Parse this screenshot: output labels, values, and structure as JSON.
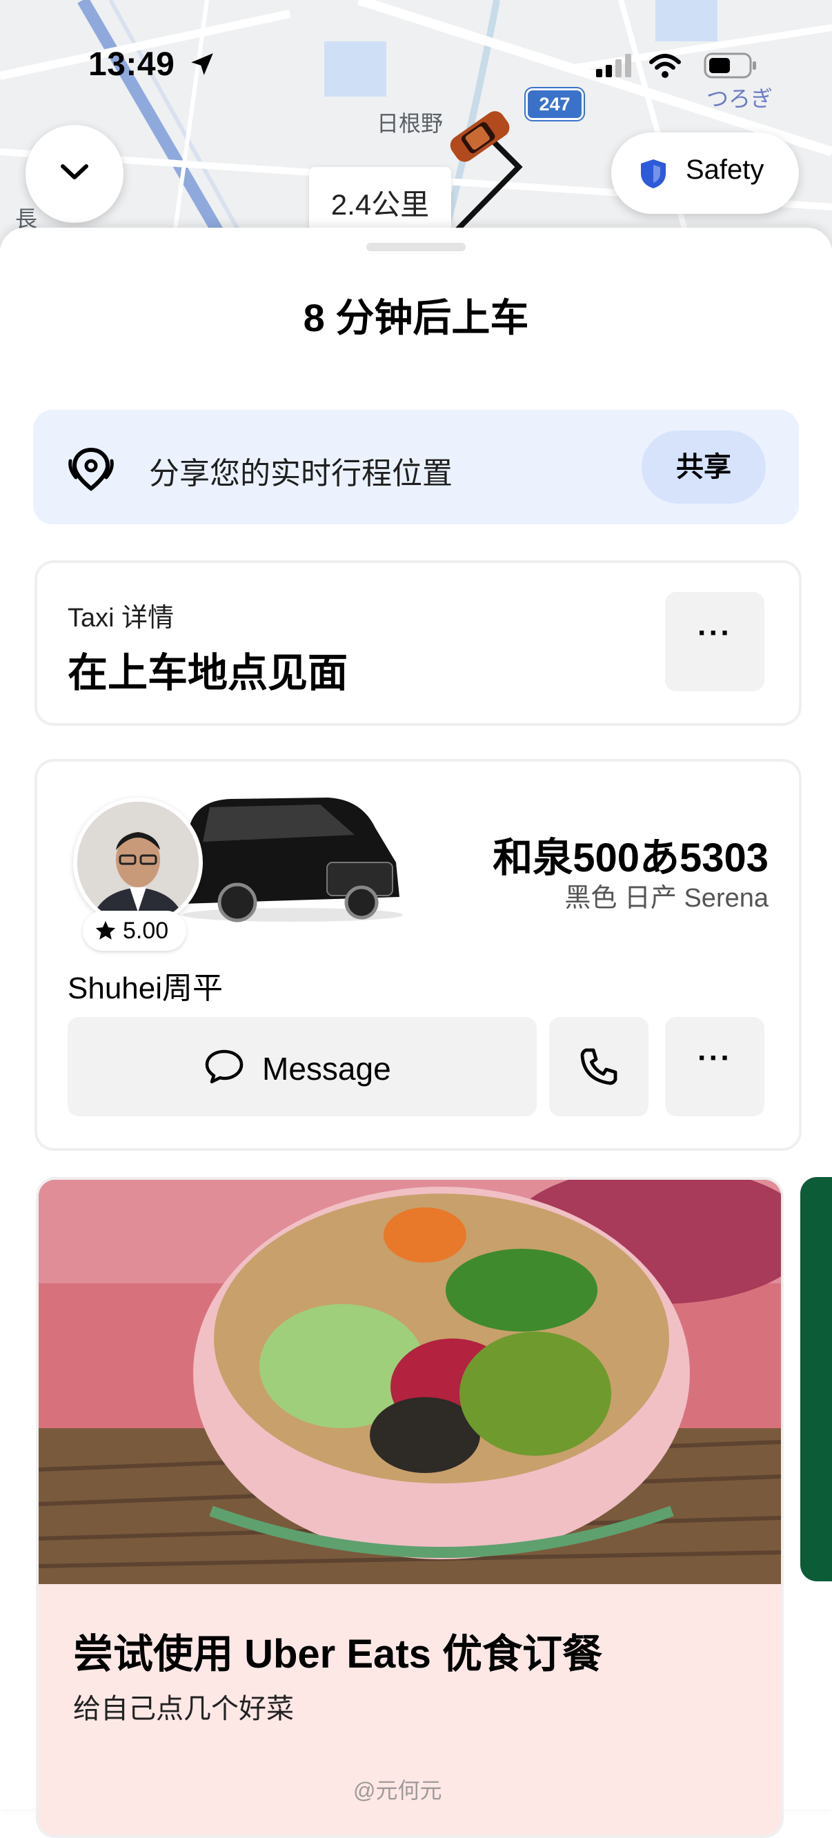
{
  "status_bar": {
    "time": "13:49"
  },
  "map": {
    "labels": {
      "hinenо": "日根野",
      "tsurugi": "つろぎ",
      "naga": "長"
    },
    "route_number": "247",
    "distance": "2.4公里",
    "safety_label": "Safety"
  },
  "sheet": {
    "eta_title": "8 分钟后上车",
    "share": {
      "text": "分享您的实时行程位置",
      "button": "共享"
    },
    "taxi": {
      "label": "Taxi 详情",
      "value": "在上车地点见面",
      "more": "···"
    },
    "driver": {
      "rating": "5.00",
      "plate": "和泉500あ5303",
      "vehicle": "黑色 日产 Serena",
      "name": "Shuhei周平",
      "message_label": "Message",
      "more": "···"
    },
    "promo": {
      "title": "尝试使用 Uber Eats 优食订餐",
      "subtitle": "给自己点几个好菜"
    },
    "watermark": "@元何元"
  },
  "colors": {
    "accent_blue": "#3a72c9",
    "share_bg": "#ebf2fe",
    "promo_bg": "#fde8e6",
    "car": "#b24a1e"
  },
  "icons": [
    "location-arrow-icon",
    "signal-icon",
    "wifi-icon",
    "battery-icon",
    "chevron-down-icon",
    "shield-icon",
    "car-icon",
    "location-pin-icon",
    "star-icon",
    "chat-bubble-icon",
    "phone-icon",
    "more-icon"
  ]
}
